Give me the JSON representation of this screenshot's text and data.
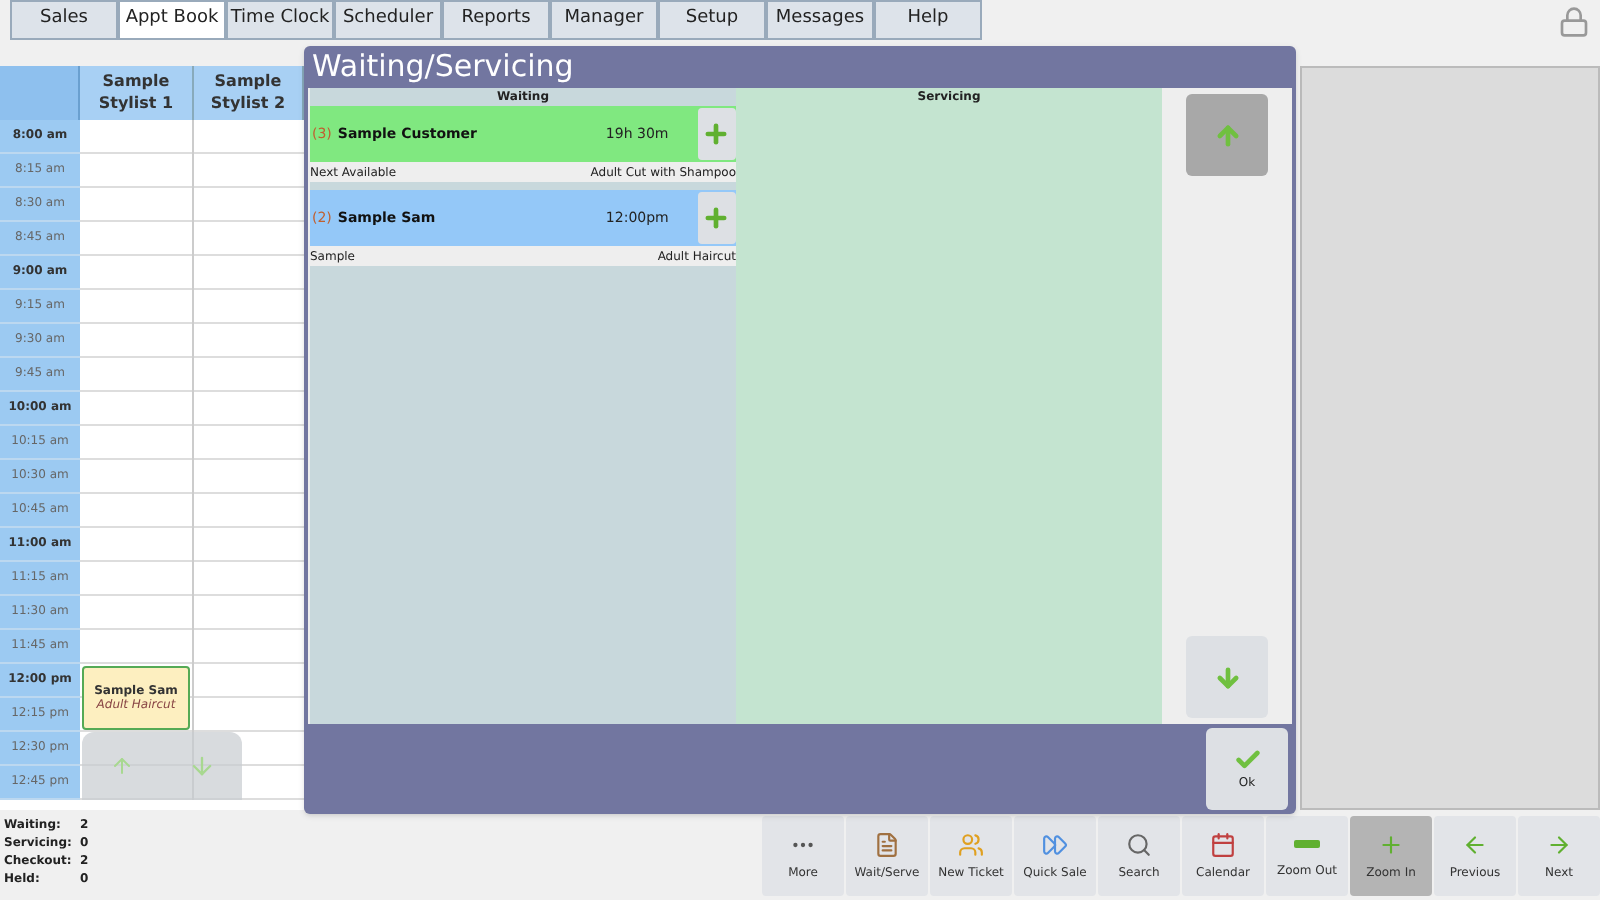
{
  "tabs": [
    {
      "label": "Sales",
      "selected": false
    },
    {
      "label": "Appt Book",
      "selected": true
    },
    {
      "label": "Time Clock",
      "selected": false
    },
    {
      "label": "Scheduler",
      "selected": false
    },
    {
      "label": "Reports",
      "selected": false
    },
    {
      "label": "Manager",
      "selected": false
    },
    {
      "label": "Setup",
      "selected": false
    },
    {
      "label": "Messages",
      "selected": false
    },
    {
      "label": "Help",
      "selected": false
    }
  ],
  "schedule": {
    "stylists": [
      "Sample Stylist 1",
      "Sample Stylist 2"
    ],
    "rows": [
      {
        "time": "8:00 am",
        "major": true
      },
      {
        "time": "8:15 am",
        "major": false
      },
      {
        "time": "8:30 am",
        "major": false
      },
      {
        "time": "8:45 am",
        "major": false
      },
      {
        "time": "9:00 am",
        "major": true
      },
      {
        "time": "9:15 am",
        "major": false
      },
      {
        "time": "9:30 am",
        "major": false
      },
      {
        "time": "9:45 am",
        "major": false
      },
      {
        "time": "10:00 am",
        "major": true
      },
      {
        "time": "10:15 am",
        "major": false
      },
      {
        "time": "10:30 am",
        "major": false
      },
      {
        "time": "10:45 am",
        "major": false
      },
      {
        "time": "11:00 am",
        "major": true
      },
      {
        "time": "11:15 am",
        "major": false
      },
      {
        "time": "11:30 am",
        "major": false
      },
      {
        "time": "11:45 am",
        "major": false
      },
      {
        "time": "12:00 pm",
        "major": true,
        "appointment": {
          "name": "Sample Sam",
          "service": "Adult Haircut"
        }
      },
      {
        "time": "12:15 pm",
        "major": false
      },
      {
        "time": "12:30 pm",
        "major": false
      },
      {
        "time": "12:45 pm",
        "major": false
      }
    ]
  },
  "dialog": {
    "title": "Waiting/Servicing",
    "waiting_header": "Waiting",
    "servicing_header": "Servicing",
    "waiting": [
      {
        "number": "(3)",
        "name": "Sample Customer",
        "time": "19h 30m",
        "stylist": "Next Available",
        "service": "Adult Cut with Shampoo",
        "color": "#80e880"
      },
      {
        "number": "(2)",
        "name": "Sample Sam",
        "time": "12:00pm",
        "stylist": "Sample",
        "service": "Adult Haircut",
        "color": "#94c8f8"
      }
    ],
    "ok_label": "Ok"
  },
  "stats": [
    {
      "label": "Waiting:",
      "value": "2"
    },
    {
      "label": "Servicing:",
      "value": "0"
    },
    {
      "label": "Checkout:",
      "value": "2"
    },
    {
      "label": "Held:",
      "value": "0"
    }
  ],
  "toolbar": [
    {
      "label": "More",
      "selected": false
    },
    {
      "label": "Wait/Serve",
      "selected": false
    },
    {
      "label": "New Ticket",
      "selected": false
    },
    {
      "label": "Quick Sale",
      "selected": false
    },
    {
      "label": "Search",
      "selected": false
    },
    {
      "label": "Calendar",
      "selected": false
    },
    {
      "label": "Zoom Out",
      "selected": false
    },
    {
      "label": "Zoom In",
      "selected": true
    },
    {
      "label": "Previous",
      "selected": false
    },
    {
      "label": "Next",
      "selected": false
    }
  ]
}
